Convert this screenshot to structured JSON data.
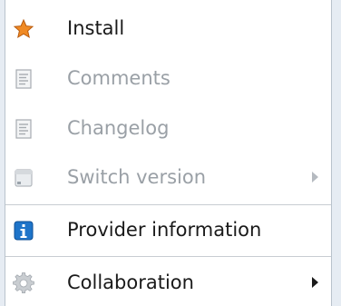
{
  "menu": {
    "items": [
      {
        "label": "Install",
        "icon": "star-icon",
        "enabled": true
      },
      {
        "label": "Comments",
        "icon": "document-icon",
        "enabled": false
      },
      {
        "label": "Changelog",
        "icon": "document-icon",
        "enabled": false
      },
      {
        "label": "Switch version",
        "icon": "package-icon",
        "enabled": false,
        "submenu": true
      },
      {
        "label": "Provider information",
        "icon": "info-icon",
        "enabled": true
      },
      {
        "label": "Collaboration",
        "icon": "gear-icon",
        "enabled": true,
        "submenu": true
      }
    ]
  },
  "colors": {
    "accent_star": "#f08a24",
    "info_blue": "#1e74c9",
    "disabled_text": "#9aa0a6",
    "enabled_text": "#1a1a1a"
  }
}
